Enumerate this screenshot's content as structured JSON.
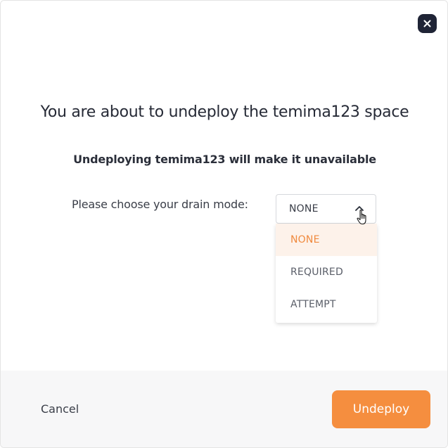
{
  "dialog": {
    "title": "You are about to undeploy the temima123 space",
    "subtitle": "Undeploying temima123 will make it unavailable",
    "drain_label": "Please choose your drain mode:",
    "close_icon": "close-icon"
  },
  "drain_select": {
    "value": "NONE",
    "chevron_icon": "chevron-up-icon",
    "options": [
      {
        "label": "NONE",
        "selected": true
      },
      {
        "label": "REQUIRED",
        "selected": false
      },
      {
        "label": "ATTEMPT",
        "selected": false
      }
    ]
  },
  "footer": {
    "cancel_label": "Cancel",
    "undeploy_label": "Undeploy"
  },
  "colors": {
    "accent": "#f58e3f",
    "selected_text": "#f08a3e",
    "selected_bg": "#fdf2ea",
    "close_bg": "#1f2436"
  }
}
